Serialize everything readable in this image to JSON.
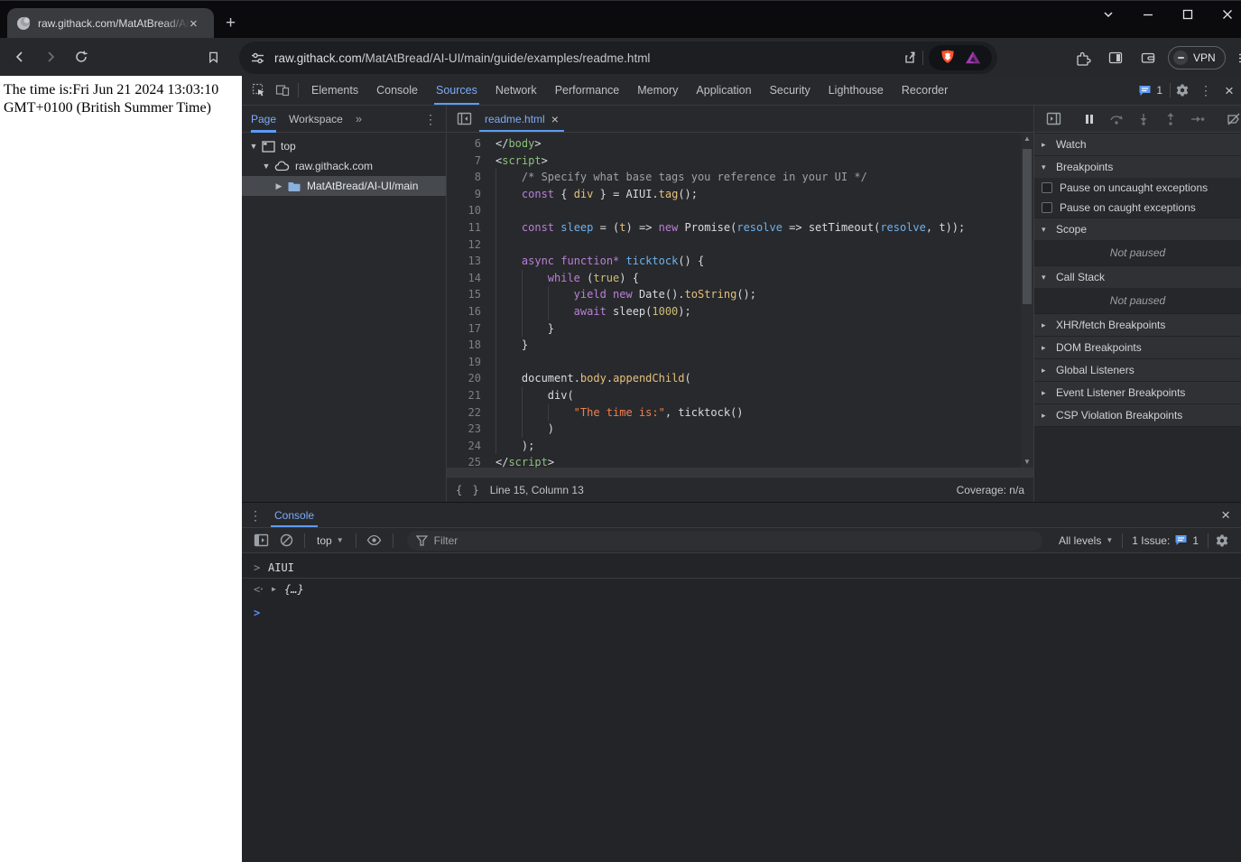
{
  "colors": {
    "accent_blue": "#7cacf8",
    "underline_blue": "#5c9cf5",
    "shield_orange": "#fb542b",
    "bat_purple": "#a43ab2",
    "selection_gray": "#46494e",
    "editor_bg": "#28292c",
    "page_bg": "#ffffff"
  },
  "icons": {
    "kebab": "⋮",
    "overflow": "»",
    "close": "×",
    "twisty_open": "▼",
    "twisty_closed": "▶",
    "sect_open": "▾",
    "sect_closed": "▸",
    "dd_arrow": "▼",
    "up_arrow": "▲",
    "down_arrow": "▼",
    "prompt": ">",
    "echo_caret": ">",
    "result_arrow": "<·",
    "result_twisty": "▶",
    "braces": "{ }"
  },
  "browser": {
    "tab_title": "raw.githack.com/MatAtBread/AI",
    "url_host": "raw.githack.com",
    "url_path": "/MatAtBread/AI-UI/main/guide/examples/readme.html",
    "vpn_label": "VPN"
  },
  "page": {
    "body_text": "The time is:Fri Jun 21 2024 13:03:10 GMT+0100 (British Summer Time)"
  },
  "devtools": {
    "tabs": [
      {
        "label": "Elements"
      },
      {
        "label": "Console"
      },
      {
        "label": "Sources"
      },
      {
        "label": "Network"
      },
      {
        "label": "Performance"
      },
      {
        "label": "Memory"
      },
      {
        "label": "Application"
      },
      {
        "label": "Security"
      },
      {
        "label": "Lighthouse"
      },
      {
        "label": "Recorder"
      }
    ],
    "issues_count": "1",
    "navigator": {
      "tabs": [
        {
          "label": "Page"
        },
        {
          "label": "Workspace"
        }
      ],
      "tree": [
        {
          "label": "top"
        },
        {
          "label": "raw.githack.com"
        },
        {
          "label": "MatAtBread/AI-UI/main"
        }
      ]
    },
    "editor": {
      "file_tab": "readme.html",
      "status_line": "Line 15, Column 13",
      "coverage": "Coverage: n/a",
      "code_lines": [
        {
          "n": "6",
          "g": 0,
          "tok": [
            [
              "w",
              "</"
            ],
            [
              "t",
              "body"
            ],
            [
              "w",
              ">"
            ]
          ]
        },
        {
          "n": "7",
          "g": 0,
          "tok": [
            [
              "w",
              "<"
            ],
            [
              "t",
              "script"
            ],
            [
              "w",
              ">"
            ]
          ]
        },
        {
          "n": "8",
          "g": 1,
          "tok": [
            [
              "c",
              "/* Specify what base tags you reference in your UI */"
            ]
          ]
        },
        {
          "n": "9",
          "g": 1,
          "tok": [
            [
              "k",
              "const"
            ],
            [
              "w",
              " { "
            ],
            [
              "p",
              "div"
            ],
            [
              "w",
              " } = AIUI."
            ],
            [
              "p",
              "tag"
            ],
            [
              "w",
              "();"
            ]
          ]
        },
        {
          "n": "10",
          "g": 1,
          "tok": []
        },
        {
          "n": "11",
          "g": 1,
          "tok": [
            [
              "k",
              "const"
            ],
            [
              "w",
              " "
            ],
            [
              "d",
              "sleep"
            ],
            [
              "w",
              " = ("
            ],
            [
              "p",
              "t"
            ],
            [
              "w",
              ") => "
            ],
            [
              "k",
              "new"
            ],
            [
              "w",
              " Promise("
            ],
            [
              "d",
              "resolve"
            ],
            [
              "w",
              " => setTimeout("
            ],
            [
              "d",
              "resolve"
            ],
            [
              "w",
              ", t));"
            ]
          ]
        },
        {
          "n": "12",
          "g": 1,
          "tok": []
        },
        {
          "n": "13",
          "g": 1,
          "tok": [
            [
              "k",
              "async"
            ],
            [
              "w",
              " "
            ],
            [
              "k",
              "function*"
            ],
            [
              "w",
              " "
            ],
            [
              "d",
              "ticktock"
            ],
            [
              "w",
              "() {"
            ]
          ]
        },
        {
          "n": "14",
          "g": 2,
          "tok": [
            [
              "k",
              "while"
            ],
            [
              "w",
              " ("
            ],
            [
              "n",
              "true"
            ],
            [
              "w",
              ") {"
            ]
          ]
        },
        {
          "n": "15",
          "g": 3,
          "tok": [
            [
              "k",
              "yield"
            ],
            [
              "w",
              " "
            ],
            [
              "k",
              "new"
            ],
            [
              "w",
              " Date()."
            ],
            [
              "p",
              "toString"
            ],
            [
              "w",
              "();"
            ]
          ]
        },
        {
          "n": "16",
          "g": 3,
          "tok": [
            [
              "k",
              "await"
            ],
            [
              "w",
              " sleep("
            ],
            [
              "n",
              "1000"
            ],
            [
              "w",
              ");"
            ]
          ]
        },
        {
          "n": "17",
          "g": 2,
          "tok": [
            [
              "w",
              "}"
            ]
          ]
        },
        {
          "n": "18",
          "g": 1,
          "tok": [
            [
              "w",
              "}"
            ]
          ]
        },
        {
          "n": "19",
          "g": 1,
          "tok": []
        },
        {
          "n": "20",
          "g": 1,
          "tok": [
            [
              "w",
              "document."
            ],
            [
              "p",
              "body"
            ],
            [
              "w",
              "."
            ],
            [
              "p",
              "appendChild"
            ],
            [
              "w",
              "("
            ]
          ]
        },
        {
          "n": "21",
          "g": 2,
          "tok": [
            [
              "w",
              "div("
            ]
          ]
        },
        {
          "n": "22",
          "g": 3,
          "tok": [
            [
              "s",
              "\"The time is:\""
            ],
            [
              "w",
              ", ticktock()"
            ]
          ]
        },
        {
          "n": "23",
          "g": 2,
          "tok": [
            [
              "w",
              ")"
            ]
          ]
        },
        {
          "n": "24",
          "g": 1,
          "tok": [
            [
              "w",
              ");"
            ]
          ]
        },
        {
          "n": "25",
          "g": 0,
          "tok": [
            [
              "w",
              "</"
            ],
            [
              "t",
              "script"
            ],
            [
              "w",
              ">"
            ]
          ]
        }
      ]
    },
    "debugger": {
      "sections": [
        {
          "label": "Watch"
        },
        {
          "label": "Breakpoints"
        },
        {
          "label": "Scope"
        },
        {
          "label": "Call Stack"
        },
        {
          "label": "XHR/fetch Breakpoints"
        },
        {
          "label": "DOM Breakpoints"
        },
        {
          "label": "Global Listeners"
        },
        {
          "label": "Event Listener Breakpoints"
        },
        {
          "label": "CSP Violation Breakpoints"
        }
      ],
      "checkboxes": [
        {
          "label": "Pause on uncaught exceptions"
        },
        {
          "label": "Pause on caught exceptions"
        }
      ],
      "not_paused": "Not paused"
    },
    "console": {
      "tab_label": "Console",
      "context": "top",
      "filter_placeholder": "Filter",
      "levels_label": "All levels",
      "issue_label": "1 Issue:",
      "issue_count": "1",
      "echo_command": "AIUI",
      "result_preview": "{…}"
    }
  }
}
